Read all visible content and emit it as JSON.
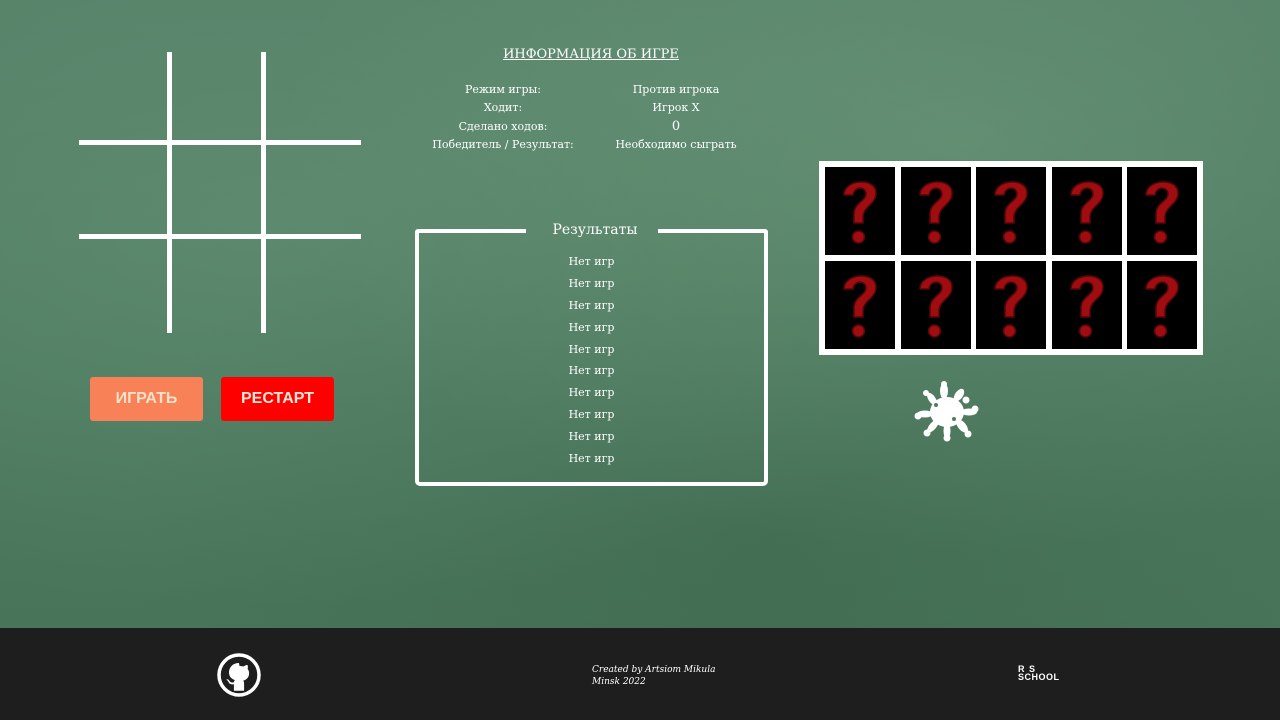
{
  "info": {
    "title": "ИНФОРМАЦИЯ ОБ ИГРЕ",
    "rows": [
      {
        "label": "Режим игры:",
        "value": "Против игрока"
      },
      {
        "label": "Ходит:",
        "value": "Игрок X"
      },
      {
        "label": "Сделано ходов:",
        "value": "0"
      },
      {
        "label": "Победитель / Результат:",
        "value": "Необходимо сыграть"
      }
    ]
  },
  "results": {
    "title": "Результаты",
    "items": [
      "Нет игр",
      "Нет игр",
      "Нет игр",
      "Нет игр",
      "Нет игр",
      "Нет игр",
      "Нет игр",
      "Нет игр",
      "Нет игр",
      "Нет игр"
    ]
  },
  "buttons": {
    "play": "ИГРАТЬ",
    "restart": "РЕСТАРТ"
  },
  "cards": {
    "count": 10,
    "icon": "question-mark-icon",
    "color": "#a00d10"
  },
  "footer": {
    "credit_line1": "Created by Artsiom Mikula",
    "credit_line2": "Minsk 2022",
    "logo_r": "R",
    "logo_s": "S",
    "logo_school": "SCHOOL",
    "github_icon": "github-icon"
  },
  "colors": {
    "play_button": "#f98158",
    "restart_button": "#ff0000",
    "footer_bg": "#1e1e1e"
  }
}
